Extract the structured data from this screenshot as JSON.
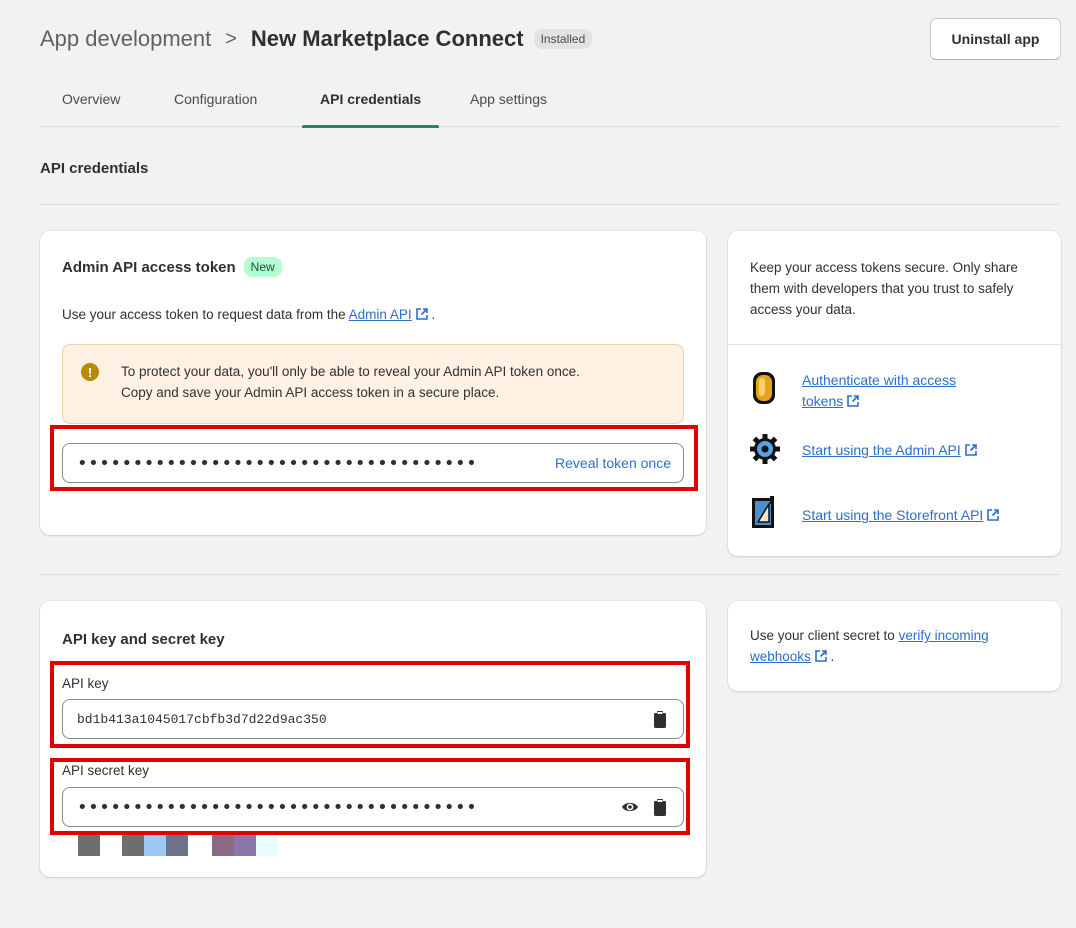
{
  "header": {
    "breadcrumb_parent": "App development",
    "breadcrumb_separator": ">",
    "app_title": "New Marketplace Connect",
    "status_badge": "Installed",
    "uninstall_label": "Uninstall app"
  },
  "tabs": [
    {
      "label": "Overview",
      "active": false
    },
    {
      "label": "Configuration",
      "active": false
    },
    {
      "label": "API credentials",
      "active": true
    },
    {
      "label": "App settings",
      "active": false
    }
  ],
  "section_title": "API credentials",
  "admin_token_card": {
    "title": "Admin API access token",
    "badge": "New",
    "description_prefix": "Use your access token to request data from the ",
    "description_link": "Admin API",
    "description_suffix": " .",
    "warning_line1": "To protect your data, you'll only be able to reveal your Admin API token once.",
    "warning_line2": "Copy and save your Admin API access token in a secure place.",
    "token_masked": "••••••••••••••••••••••••••••••••••••",
    "reveal_label": "Reveal token once"
  },
  "tips_card": {
    "text": "Keep your access tokens secure. Only share them with developers that you trust to safely access your data.",
    "links": [
      {
        "label_line1": "Authenticate with access",
        "label_line2": "tokens",
        "icon": "coin-icon"
      },
      {
        "label_line1": "Start using the Admin API",
        "label_line2": "",
        "icon": "gear-icon"
      },
      {
        "label_line1": "Start using the Storefront API",
        "label_line2": "",
        "icon": "ruler-icon"
      }
    ]
  },
  "keys_card": {
    "title": "API key and secret key",
    "api_key_label": "API key",
    "api_key_value": "bd1b413a1045017cbfb3d7d22d9ac350",
    "secret_label": "API secret key",
    "secret_masked": "••••••••••••••••••••••••••••••••••••"
  },
  "webhook_card": {
    "prefix": "Use your client secret to ",
    "link_line1": "verify incoming",
    "link_line2": "webhooks",
    "suffix": " ."
  },
  "colors": {
    "accent_green": "#1f8a5b",
    "link_blue": "#2c6ecb",
    "highlight_red": "#e00000",
    "warning_bg": "#fff1e3"
  }
}
